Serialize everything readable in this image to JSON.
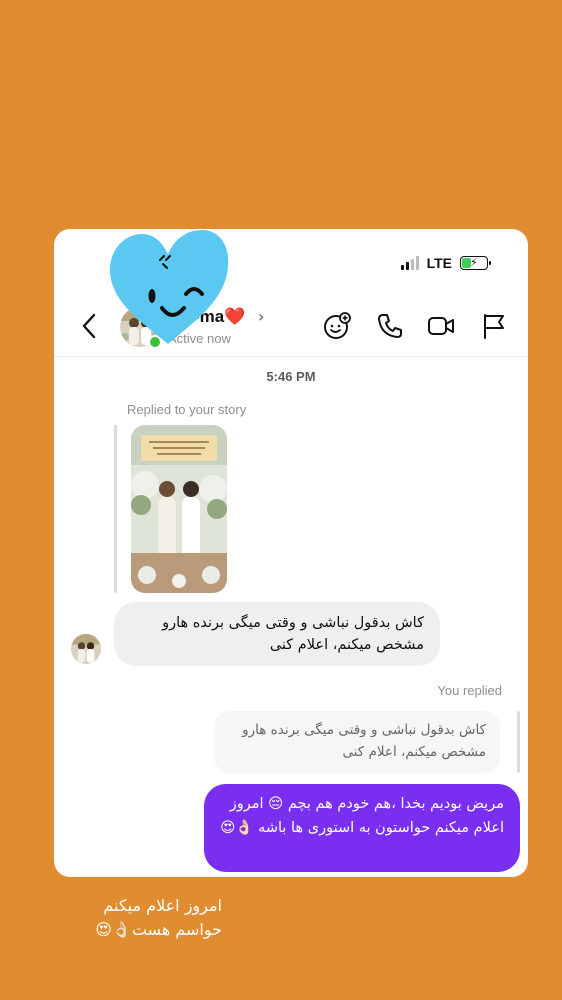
{
  "status_bar": {
    "network": "LTE"
  },
  "header": {
    "name_visible": "-ma",
    "name_emoji": "❤️",
    "status": "Active now",
    "icons": [
      "back-chevron-icon",
      "sticker-chat-icon",
      "phone-icon",
      "video-camera-icon",
      "flag-icon"
    ]
  },
  "thread": {
    "timestamp": "5:46 PM",
    "story_reply_label": "Replied to your story",
    "incoming_message": "کاش بدقول نباشی و وقتی میگی برنده هارو مشخص میکنم، اعلام کنی",
    "you_replied_label": "You replied",
    "quoted_message": "کاش بدقول نباشی و وقتی میگی برنده هارو مشخص میکنم، اعلام کنی",
    "outgoing_message": "مریض بودیم بخدا ،هم خودم هم بچم 😔 امروز اعلام میکنم حواستون به استوری ها باشه 👌🏻😍"
  },
  "caption": "امروز اعلام میکنم حواسم هست👌🏻😍",
  "colors": {
    "background": "#E08C31",
    "outgoing_bubble": "#7A2FF0",
    "incoming_bubble": "#EFEFEF",
    "sticker_heart": "#5BC8F2",
    "online_dot": "#3CC13B"
  }
}
